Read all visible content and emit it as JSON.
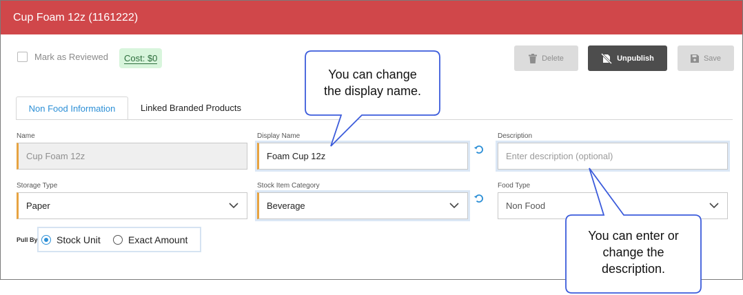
{
  "header": {
    "title": "Cup Foam 12z (1161222)"
  },
  "toolbar": {
    "mark_reviewed_label": "Mark as Reviewed",
    "cost_label": "Cost: $0",
    "delete_label": "Delete",
    "unpublish_label": "Unpublish",
    "save_label": "Save"
  },
  "tabs": [
    {
      "label": "Non Food Information",
      "active": true
    },
    {
      "label": "Linked Branded Products",
      "active": false
    }
  ],
  "fields": {
    "name": {
      "label": "Name",
      "value": "Cup Foam 12z"
    },
    "display_name": {
      "label": "Display Name",
      "value": "Foam Cup 12z"
    },
    "description": {
      "label": "Description",
      "placeholder": "Enter description (optional)"
    },
    "storage_type": {
      "label": "Storage Type",
      "value": "Paper"
    },
    "stock_item_category": {
      "label": "Stock Item Category",
      "value": "Beverage"
    },
    "food_type": {
      "label": "Food Type",
      "value": "Non Food"
    }
  },
  "pull_by": {
    "label": "Pull By",
    "options": [
      {
        "label": "Stock Unit",
        "checked": true
      },
      {
        "label": "Exact Amount",
        "checked": false
      }
    ]
  },
  "callouts": {
    "display_name": {
      "line1": "You can change",
      "line2": "the display name."
    },
    "description": {
      "line1": "You can enter or",
      "line2": "change the",
      "line3": "description."
    }
  },
  "colors": {
    "header": "#d0474a",
    "accent_blue": "#2c8fd6",
    "required_bar": "#e7a341",
    "unpublish_bg": "#4d4d4d",
    "cost_bg": "#d8f5dc",
    "callout_border": "#3b5bdb"
  }
}
